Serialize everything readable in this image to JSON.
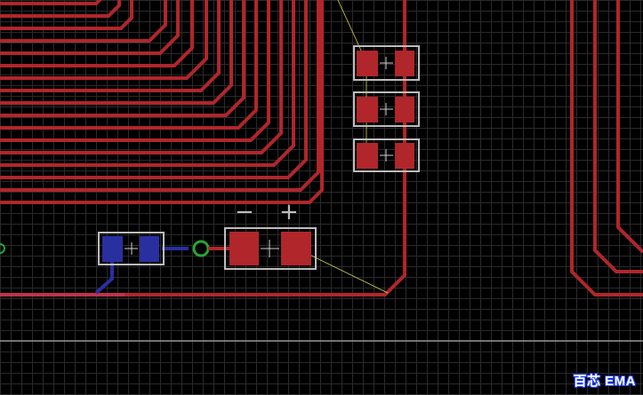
{
  "editor": {
    "watermark_text": "百芯 EMA",
    "colors": {
      "background": "#000000",
      "grid": "#2a2a2a",
      "top_copper": "#b0262b",
      "bottom_copper": "#2a2fa0",
      "silkscreen": "#bdbdbd",
      "ratsnest": "#d8d84a",
      "via_ring": "#2aa336",
      "board_outline": "#cfcfcf",
      "highlight_trace": "#c0324a"
    }
  },
  "components": {
    "capacitor_polarity_minus": "−",
    "capacitor_polarity_plus": "+"
  }
}
